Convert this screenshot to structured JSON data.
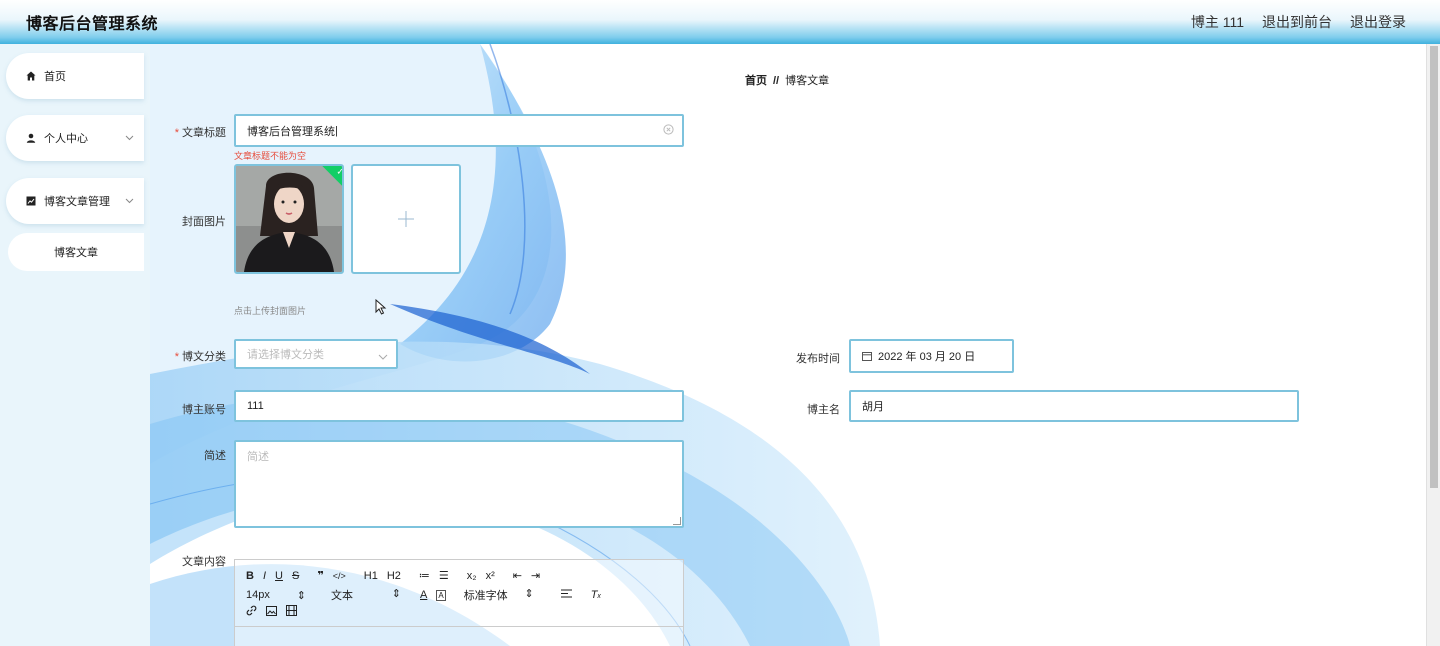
{
  "header": {
    "app_title": "博客后台管理系统",
    "user_label": "博主 111",
    "front_link": "退出到前台",
    "logout_link": "退出登录"
  },
  "sidebar": {
    "items": [
      {
        "label": "首页",
        "icon": "home-icon"
      },
      {
        "label": "个人中心",
        "icon": "user-icon"
      },
      {
        "label": "博客文章管理",
        "icon": "chart-icon"
      }
    ],
    "sub_item": "博客文章"
  },
  "breadcrumb": {
    "home": "首页",
    "separator": "//",
    "current": "博客文章"
  },
  "form": {
    "title_label": "文章标题",
    "title_value": "博客后台管理系统",
    "title_error": "文章标题不能为空",
    "cover_label": "封面图片",
    "cover_hint": "点击上传封面图片",
    "category_label": "博文分类",
    "category_placeholder": "请选择博文分类",
    "publish_label": "发布时间",
    "publish_value": "2022 年 03 月 20 日",
    "account_label": "博主账号",
    "account_value": "111",
    "blogger_label": "博主名",
    "blogger_value": "胡月",
    "summary_label": "简述",
    "summary_placeholder": "简述",
    "content_label": "文章内容"
  },
  "editor_toolbar": {
    "row1": [
      "B",
      "I",
      "U",
      "S",
      "❞",
      "</>",
      "H1",
      "H2",
      "≔",
      "☰",
      "x₂",
      "x²",
      "⇤",
      "⇥"
    ],
    "font_size": "14px",
    "header_select": "文本",
    "font_family": "标准字体",
    "icons": [
      "font-color-icon",
      "bg-color-icon",
      "align-icon",
      "clear-format-icon",
      "link-icon",
      "image-icon",
      "video-icon"
    ]
  },
  "colors": {
    "accent": "#7ec3dd",
    "error": "#e74c3c",
    "success": "#13ce66",
    "sidebar_bg": "#e9f5fb"
  }
}
